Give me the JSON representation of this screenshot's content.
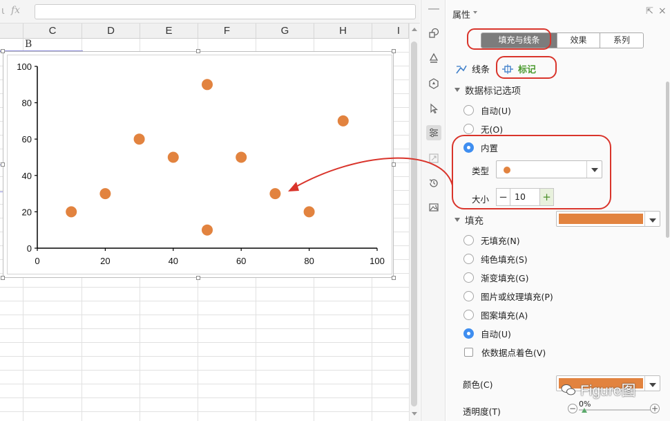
{
  "colors": {
    "marker": "#e2833f",
    "annotation": "#d9342b",
    "active_green": "#4a9a2e",
    "radio_blue": "#3f8ef0"
  },
  "formula_bar": {
    "fx_label": "fx",
    "cut_glyph": "ι"
  },
  "spreadsheet": {
    "columns": [
      "C",
      "D",
      "E",
      "F",
      "G",
      "H",
      "I"
    ],
    "cell_text": "B"
  },
  "chart_data": {
    "type": "scatter",
    "title": "",
    "xlabel": "",
    "ylabel": "",
    "xlim": [
      0,
      100
    ],
    "ylim": [
      0,
      100
    ],
    "x_ticks": [
      "0",
      "20",
      "40",
      "60",
      "80",
      "100"
    ],
    "y_ticks": [
      "0",
      "20",
      "40",
      "60",
      "80",
      "100"
    ],
    "grid": false,
    "series": [
      {
        "name": "",
        "marker": "circle",
        "color": "#e2833f",
        "points": [
          {
            "x": 10,
            "y": 20
          },
          {
            "x": 20,
            "y": 30
          },
          {
            "x": 30,
            "y": 60
          },
          {
            "x": 40,
            "y": 50
          },
          {
            "x": 50,
            "y": 90
          },
          {
            "x": 50,
            "y": 10
          },
          {
            "x": 60,
            "y": 50
          },
          {
            "x": 70,
            "y": 30
          },
          {
            "x": 80,
            "y": 20
          },
          {
            "x": 90,
            "y": 70
          }
        ]
      }
    ]
  },
  "icon_strip": [
    "shapes-icon",
    "fill-icon",
    "hexagon-icon",
    "cursor-icon",
    "sliders-icon",
    "transform-icon",
    "history-icon",
    "image-icon"
  ],
  "panel": {
    "title": "属性",
    "tabs": [
      "填充与线条",
      "效果",
      "系列"
    ],
    "active_tab": "填充与线条",
    "subtabs": [
      "线条",
      "标记"
    ],
    "active_subtab": "标记",
    "marker_section": {
      "title": "数据标记选项",
      "options": [
        "自动(U)",
        "无(O)",
        "内置"
      ],
      "selected": "内置",
      "type_label": "类型",
      "type_value": "circle",
      "size_label": "大小",
      "size_value": "10",
      "minus": "−",
      "plus": "+"
    },
    "fill_section": {
      "title": "填充",
      "color": "#e2833f",
      "options": [
        "无填充(N)",
        "纯色填充(S)",
        "渐变填充(G)",
        "图片或纹理填充(P)",
        "图案填充(A)",
        "自动(U)"
      ],
      "selected": "自动(U)",
      "vary_by_point": "依数据点着色(V)",
      "vary_checked": false
    },
    "color_label": "颜色(C)",
    "transparency_label": "透明度(T)",
    "transparency_value": "0%",
    "transparency": 0
  },
  "watermark": "Figure图"
}
